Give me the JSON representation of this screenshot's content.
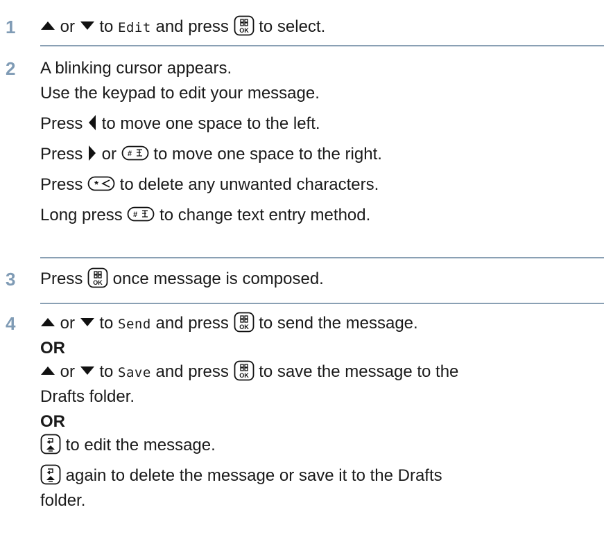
{
  "steps": [
    {
      "number": "1",
      "lines": {
        "l1": {
          "t1": " or ",
          "t2": " to ",
          "menu": "Edit",
          "t3": " and press ",
          "t4": " to select."
        }
      }
    },
    {
      "number": "2",
      "lines": {
        "l1": "A blinking cursor appears.",
        "l2": "Use the keypad to edit your message.",
        "l3": {
          "a": "Press ",
          "b": " to move one space to the left."
        },
        "l4": {
          "a": "Press ",
          "b": " or ",
          "c": " to move one space to the right."
        },
        "l5": {
          "a": "Press ",
          "b": " to delete any unwanted characters."
        },
        "l6": {
          "a": "Long press ",
          "b": " to change text entry method."
        }
      }
    },
    {
      "number": "3",
      "lines": {
        "l1": {
          "a": "Press ",
          "b": " once message is composed."
        }
      }
    },
    {
      "number": "4",
      "lines": {
        "l1": {
          "t1": " or ",
          "t2": " to ",
          "menu": "Send",
          "t3": " and press ",
          "t4": " to send the message."
        },
        "or1": "OR",
        "l2": {
          "t1": " or ",
          "t2": " to ",
          "menu": "Save",
          "t3": " and press ",
          "t4": " to save the message to the"
        },
        "l3": "Drafts folder.",
        "or2": "OR",
        "l4": " to edit the message.",
        "l5": " again to delete the message or save it to the Drafts",
        "l6": "folder."
      }
    }
  ],
  "icons": {
    "up": "up-arrow-icon",
    "down": "down-arrow-icon",
    "left": "left-arrow-icon",
    "right": "right-arrow-icon",
    "menu_ok": "menu-ok-key-icon",
    "hash": "hash-key-icon",
    "star": "star-key-icon",
    "back_home": "back-home-key-icon"
  },
  "ok_key_text": "OK",
  "colors": {
    "step_number": "#7f9bb5",
    "rule": "#8aa0b4",
    "text": "#1a1a1a"
  }
}
